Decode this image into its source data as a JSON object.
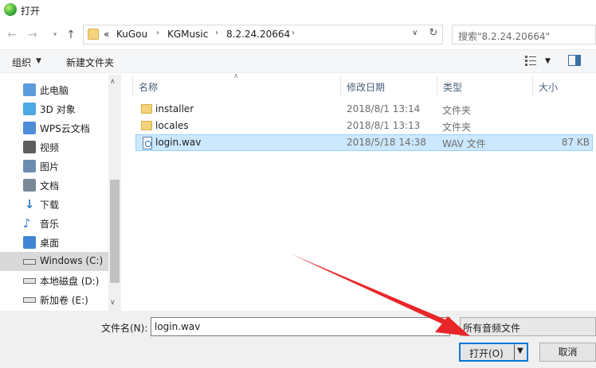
{
  "window": {
    "title": "打开",
    "app_icon": "app-icon"
  },
  "nav": {
    "back_icon": "back-arrow-icon",
    "forward_icon": "forward-arrow-icon",
    "up_icon": "up-arrow-icon",
    "overflow": "«",
    "breadcrumb": [
      "KuGou",
      "KGMusic",
      "8.2.24.20664"
    ],
    "search_placeholder": "搜索\"8.2.24.20664\""
  },
  "toolbar": {
    "organize": "组织",
    "new_folder": "新建文件夹"
  },
  "sidebar": {
    "items": [
      {
        "label": "此电脑",
        "icon": "computer-icon"
      },
      {
        "label": "3D 对象",
        "icon": "cube-3d-icon"
      },
      {
        "label": "WPS云文档",
        "icon": "cloud-doc-icon"
      },
      {
        "label": "视频",
        "icon": "video-icon"
      },
      {
        "label": "图片",
        "icon": "picture-icon"
      },
      {
        "label": "文档",
        "icon": "document-icon"
      },
      {
        "label": "下载",
        "icon": "download-icon"
      },
      {
        "label": "音乐",
        "icon": "music-icon"
      },
      {
        "label": "桌面",
        "icon": "desktop-icon"
      },
      {
        "label": "Windows (C:)",
        "icon": "drive-icon"
      },
      {
        "label": "本地磁盘 (D:)",
        "icon": "drive-icon"
      },
      {
        "label": "新加卷 (E:)",
        "icon": "drive-icon"
      }
    ],
    "selected_index": 9
  },
  "columns": {
    "name": "名称",
    "modified": "修改日期",
    "type": "类型",
    "size": "大小"
  },
  "files": [
    {
      "name": "installer",
      "modified": "2018/8/1 13:14",
      "type": "文件夹",
      "size": "",
      "icon": "folder-icon"
    },
    {
      "name": "locales",
      "modified": "2018/8/1 13:13",
      "type": "文件夹",
      "size": "",
      "icon": "folder-icon"
    },
    {
      "name": "login.wav",
      "modified": "2018/5/18 14:38",
      "type": "WAV 文件",
      "size": "87 KB",
      "icon": "wav-file-icon"
    }
  ],
  "bottom": {
    "filename_label": "文件名(N):",
    "filename_value": "login.wav",
    "filter": "所有音频文件",
    "open": "打开(O)",
    "cancel": "取消"
  },
  "colors": {
    "accent": "#0078d7",
    "selection": "#cce8ff",
    "annotation_arrow": "#e8262a"
  }
}
